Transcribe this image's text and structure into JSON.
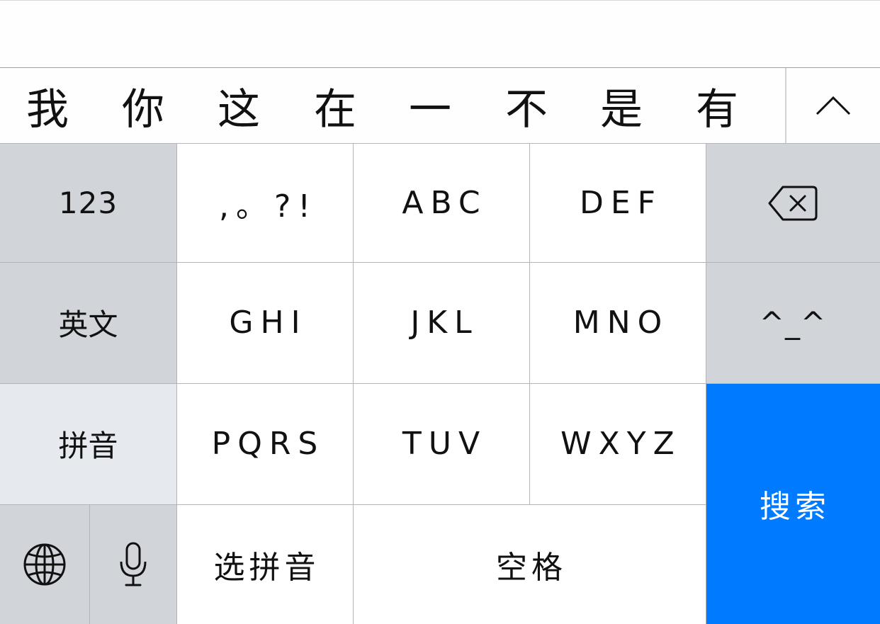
{
  "candidates": [
    "我",
    "你",
    "这",
    "在",
    "一",
    "不",
    "是",
    "有"
  ],
  "keyboard": {
    "numbers_label": "123",
    "punctuation_label": ",。?!",
    "abc_label": "ABC",
    "def_label": "DEF",
    "english_label": "英文",
    "ghi_label": "GHI",
    "jkl_label": "JKL",
    "mno_label": "MNO",
    "emoticon_label": "^_^",
    "pinyin_label": "拼音",
    "pqrs_label": "PQRS",
    "tuv_label": "TUV",
    "wxyz_label": "WXYZ",
    "search_label": "搜索",
    "select_pinyin_label": "选拼音",
    "space_label": "空格"
  },
  "icons": {
    "expand": "chevron-up-icon",
    "delete": "backspace-icon",
    "globe": "globe-icon",
    "mic": "microphone-icon"
  },
  "colors": {
    "accent": "#007aff",
    "key_white": "#ffffff",
    "key_gray": "#d1d4d9",
    "key_light": "#e6e9ee"
  }
}
